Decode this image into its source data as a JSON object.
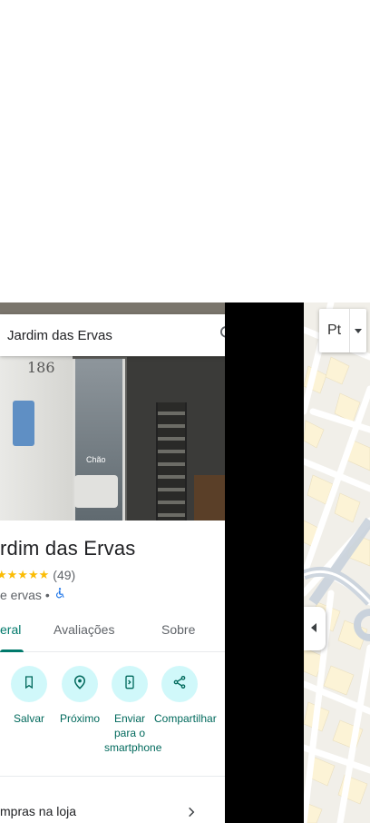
{
  "search": {
    "query": "Jardim das Ervas"
  },
  "place": {
    "title": "rdim das Ervas",
    "stars": "★★★★★",
    "rating_count": "(49)",
    "category": "e ervas",
    "separator": "•",
    "photo_number": "186",
    "photo_sign": "Chão"
  },
  "tabs": [
    {
      "label": "eral",
      "active": true
    },
    {
      "label": "Avaliações",
      "active": false
    },
    {
      "label": "Sobre",
      "active": false
    }
  ],
  "actions": [
    {
      "label": "Salvar",
      "icon": "bookmark-icon"
    },
    {
      "label": "Próximo",
      "icon": "nearby-icon"
    },
    {
      "label": "Enviar para o smartphone",
      "icon": "send-to-phone-icon"
    },
    {
      "label": "Compartilhar",
      "icon": "share-icon"
    }
  ],
  "list": {
    "item_text": "mpras na loja"
  },
  "map": {
    "layer_label": "Pt"
  },
  "colors": {
    "accent": "#00796b",
    "action_bg": "#d0f8fa",
    "star": "#fbbc04"
  }
}
